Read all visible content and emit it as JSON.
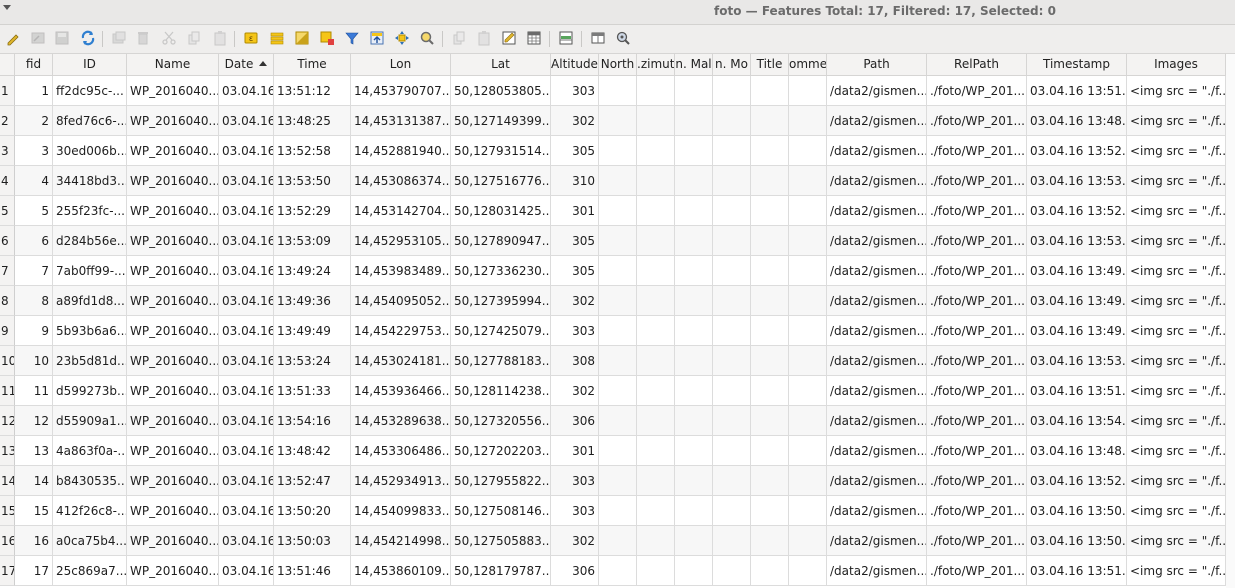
{
  "window": {
    "title": "foto — Features Total: 17, Filtered: 17, Selected: 0"
  },
  "toolbar": {
    "buttons": [
      {
        "name": "toggle-editing-icon",
        "enabled": true
      },
      {
        "name": "toggle-multi-edit-icon",
        "enabled": false
      },
      {
        "name": "save-edits-icon",
        "enabled": false
      },
      {
        "name": "reload-table-icon",
        "enabled": true
      },
      {
        "name": "add-feature-icon",
        "enabled": false
      },
      {
        "name": "delete-selected-icon",
        "enabled": false
      },
      {
        "name": "cut-icon",
        "enabled": false
      },
      {
        "name": "copy-icon",
        "enabled": false
      },
      {
        "name": "paste-icon",
        "enabled": false
      },
      {
        "name": "select-by-expression-icon",
        "enabled": true
      },
      {
        "name": "select-all-icon",
        "enabled": true
      },
      {
        "name": "invert-selection-icon",
        "enabled": true
      },
      {
        "name": "deselect-all-icon",
        "enabled": true
      },
      {
        "name": "filter-select-icon",
        "enabled": true
      },
      {
        "name": "move-selection-to-top-icon",
        "enabled": true
      },
      {
        "name": "pan-map-to-selected-icon",
        "enabled": true
      },
      {
        "name": "zoom-map-to-selected-icon",
        "enabled": true
      },
      {
        "name": "copy-rows-icon",
        "enabled": false
      },
      {
        "name": "paste-rows-icon",
        "enabled": false
      },
      {
        "name": "field-calculator-icon",
        "enabled": true
      },
      {
        "name": "conditional-formatting-icon",
        "enabled": true
      },
      {
        "name": "new-field-icon",
        "enabled": true
      },
      {
        "name": "dock-table-icon",
        "enabled": true
      },
      {
        "name": "actions-icon",
        "enabled": true
      }
    ]
  },
  "table": {
    "columns": [
      "",
      "fid",
      "ID",
      "Name",
      "Date",
      "Time",
      "Lon",
      "Lat",
      "Altitude",
      "North",
      "Azimuth",
      "Cam. Maker",
      "Cam. Model",
      "Title",
      "Comment",
      "Path",
      "RelPath",
      "Timestamp",
      "Images"
    ],
    "column_headers": [
      "",
      "fid",
      "ID",
      "Name",
      "Date",
      "Time",
      "Lon",
      "Lat",
      "Altitude",
      "North",
      ".zimut",
      "n. Mal",
      "n. Mo",
      "Title",
      "omme",
      "Path",
      "RelPath",
      "Timestamp",
      "Images"
    ],
    "sorted_column": "Date",
    "sort_order": "ascending",
    "rows": [
      {
        "row": "1",
        "fid": "1",
        "id": "ff2dc95c-...",
        "name": "WP_2016040...",
        "date": "03.04.16",
        "time": "13:51:12",
        "lon": "14,453790707...",
        "lat": "50,128053805...",
        "alt": "303",
        "north": "",
        "azimuth": "",
        "maker": "",
        "model": "",
        "title": "",
        "comment": "",
        "path": "/data2/gismen...",
        "relpath": "./foto/WP_201...",
        "timestamp": "03.04.16 13:51...",
        "images": "<img src = \"./f..."
      },
      {
        "row": "2",
        "fid": "2",
        "id": "8fed76c6-...",
        "name": "WP_2016040...",
        "date": "03.04.16",
        "time": "13:48:25",
        "lon": "14,453131387...",
        "lat": "50,127149399...",
        "alt": "302",
        "north": "",
        "azimuth": "",
        "maker": "",
        "model": "",
        "title": "",
        "comment": "",
        "path": "/data2/gismen...",
        "relpath": "./foto/WP_201...",
        "timestamp": "03.04.16 13:48...",
        "images": "<img src = \"./f..."
      },
      {
        "row": "3",
        "fid": "3",
        "id": "30ed006b...",
        "name": "WP_2016040...",
        "date": "03.04.16",
        "time": "13:52:58",
        "lon": "14,452881940...",
        "lat": "50,127931514...",
        "alt": "305",
        "north": "",
        "azimuth": "",
        "maker": "",
        "model": "",
        "title": "",
        "comment": "",
        "path": "/data2/gismen...",
        "relpath": "./foto/WP_201...",
        "timestamp": "03.04.16 13:52...",
        "images": "<img src = \"./f..."
      },
      {
        "row": "4",
        "fid": "4",
        "id": "34418bd3...",
        "name": "WP_2016040...",
        "date": "03.04.16",
        "time": "13:53:50",
        "lon": "14,453086374...",
        "lat": "50,127516776...",
        "alt": "310",
        "north": "",
        "azimuth": "",
        "maker": "",
        "model": "",
        "title": "",
        "comment": "",
        "path": "/data2/gismen...",
        "relpath": "./foto/WP_201...",
        "timestamp": "03.04.16 13:53...",
        "images": "<img src = \"./f..."
      },
      {
        "row": "5",
        "fid": "5",
        "id": "255f23fc-...",
        "name": "WP_2016040...",
        "date": "03.04.16",
        "time": "13:52:29",
        "lon": "14,453142704...",
        "lat": "50,128031425...",
        "alt": "301",
        "north": "",
        "azimuth": "",
        "maker": "",
        "model": "",
        "title": "",
        "comment": "",
        "path": "/data2/gismen...",
        "relpath": "./foto/WP_201...",
        "timestamp": "03.04.16 13:52...",
        "images": "<img src = \"./f..."
      },
      {
        "row": "6",
        "fid": "6",
        "id": "d284b56e...",
        "name": "WP_2016040...",
        "date": "03.04.16",
        "time": "13:53:09",
        "lon": "14,452953105...",
        "lat": "50,127890947...",
        "alt": "305",
        "north": "",
        "azimuth": "",
        "maker": "",
        "model": "",
        "title": "",
        "comment": "",
        "path": "/data2/gismen...",
        "relpath": "./foto/WP_201...",
        "timestamp": "03.04.16 13:53...",
        "images": "<img src = \"./f..."
      },
      {
        "row": "7",
        "fid": "7",
        "id": "7ab0ff99-...",
        "name": "WP_2016040...",
        "date": "03.04.16",
        "time": "13:49:24",
        "lon": "14,453983489...",
        "lat": "50,127336230...",
        "alt": "305",
        "north": "",
        "azimuth": "",
        "maker": "",
        "model": "",
        "title": "",
        "comment": "",
        "path": "/data2/gismen...",
        "relpath": "./foto/WP_201...",
        "timestamp": "03.04.16 13:49...",
        "images": "<img src = \"./f..."
      },
      {
        "row": "8",
        "fid": "8",
        "id": "a89fd1d8...",
        "name": "WP_2016040...",
        "date": "03.04.16",
        "time": "13:49:36",
        "lon": "14,454095052...",
        "lat": "50,127395994...",
        "alt": "302",
        "north": "",
        "azimuth": "",
        "maker": "",
        "model": "",
        "title": "",
        "comment": "",
        "path": "/data2/gismen...",
        "relpath": "./foto/WP_201...",
        "timestamp": "03.04.16 13:49...",
        "images": "<img src = \"./f..."
      },
      {
        "row": "9",
        "fid": "9",
        "id": "5b93b6a6...",
        "name": "WP_2016040...",
        "date": "03.04.16",
        "time": "13:49:49",
        "lon": "14,454229753...",
        "lat": "50,127425079...",
        "alt": "303",
        "north": "",
        "azimuth": "",
        "maker": "",
        "model": "",
        "title": "",
        "comment": "",
        "path": "/data2/gismen...",
        "relpath": "./foto/WP_201...",
        "timestamp": "03.04.16 13:49...",
        "images": "<img src = \"./f..."
      },
      {
        "row": "10",
        "fid": "10",
        "id": "23b5d81d...",
        "name": "WP_2016040...",
        "date": "03.04.16",
        "time": "13:53:24",
        "lon": "14,453024181...",
        "lat": "50,127788183...",
        "alt": "308",
        "north": "",
        "azimuth": "",
        "maker": "",
        "model": "",
        "title": "",
        "comment": "",
        "path": "/data2/gismen...",
        "relpath": "./foto/WP_201...",
        "timestamp": "03.04.16 13:53...",
        "images": "<img src = \"./f..."
      },
      {
        "row": "11",
        "fid": "11",
        "id": "d599273b...",
        "name": "WP_2016040...",
        "date": "03.04.16",
        "time": "13:51:33",
        "lon": "14,453936466...",
        "lat": "50,128114238...",
        "alt": "302",
        "north": "",
        "azimuth": "",
        "maker": "",
        "model": "",
        "title": "",
        "comment": "",
        "path": "/data2/gismen...",
        "relpath": "./foto/WP_201...",
        "timestamp": "03.04.16 13:51...",
        "images": "<img src = \"./f..."
      },
      {
        "row": "12",
        "fid": "12",
        "id": "d55909a1...",
        "name": "WP_2016040...",
        "date": "03.04.16",
        "time": "13:54:16",
        "lon": "14,453289638...",
        "lat": "50,127320556...",
        "alt": "306",
        "north": "",
        "azimuth": "",
        "maker": "",
        "model": "",
        "title": "",
        "comment": "",
        "path": "/data2/gismen...",
        "relpath": "./foto/WP_201...",
        "timestamp": "03.04.16 13:54...",
        "images": "<img src = \"./f..."
      },
      {
        "row": "13",
        "fid": "13",
        "id": "4a863f0a-...",
        "name": "WP_2016040...",
        "date": "03.04.16",
        "time": "13:48:42",
        "lon": "14,453306486...",
        "lat": "50,127202203...",
        "alt": "301",
        "north": "",
        "azimuth": "",
        "maker": "",
        "model": "",
        "title": "",
        "comment": "",
        "path": "/data2/gismen...",
        "relpath": "./foto/WP_201...",
        "timestamp": "03.04.16 13:48...",
        "images": "<img src = \"./f..."
      },
      {
        "row": "14",
        "fid": "14",
        "id": "b8430535...",
        "name": "WP_2016040...",
        "date": "03.04.16",
        "time": "13:52:47",
        "lon": "14,452934913...",
        "lat": "50,127955822...",
        "alt": "303",
        "north": "",
        "azimuth": "",
        "maker": "",
        "model": "",
        "title": "",
        "comment": "",
        "path": "/data2/gismen...",
        "relpath": "./foto/WP_201...",
        "timestamp": "03.04.16 13:52...",
        "images": "<img src = \"./f..."
      },
      {
        "row": "15",
        "fid": "15",
        "id": "412f26c8-...",
        "name": "WP_2016040...",
        "date": "03.04.16",
        "time": "13:50:20",
        "lon": "14,454099833...",
        "lat": "50,127508146...",
        "alt": "303",
        "north": "",
        "azimuth": "",
        "maker": "",
        "model": "",
        "title": "",
        "comment": "",
        "path": "/data2/gismen...",
        "relpath": "./foto/WP_201...",
        "timestamp": "03.04.16 13:50...",
        "images": "<img src = \"./f..."
      },
      {
        "row": "16",
        "fid": "16",
        "id": "a0ca75b4...",
        "name": "WP_2016040...",
        "date": "03.04.16",
        "time": "13:50:03",
        "lon": "14,454214998...",
        "lat": "50,127505883...",
        "alt": "302",
        "north": "",
        "azimuth": "",
        "maker": "",
        "model": "",
        "title": "",
        "comment": "",
        "path": "/data2/gismen...",
        "relpath": "./foto/WP_201...",
        "timestamp": "03.04.16 13:50...",
        "images": "<img src = \"./f..."
      },
      {
        "row": "17",
        "fid": "17",
        "id": "25c869a7...",
        "name": "WP_2016040...",
        "date": "03.04.16",
        "time": "13:51:46",
        "lon": "14,453860109...",
        "lat": "50,128179787...",
        "alt": "306",
        "north": "",
        "azimuth": "",
        "maker": "",
        "model": "",
        "title": "",
        "comment": "",
        "path": "/data2/gismen...",
        "relpath": "./foto/WP_201...",
        "timestamp": "03.04.16 13:51...",
        "images": "<img src = \"./f..."
      }
    ]
  },
  "colors": {
    "header_bg": "#f4f3f2",
    "grid_line": "#dcdcdc",
    "titlebar_bg": "#e9e8e7"
  }
}
